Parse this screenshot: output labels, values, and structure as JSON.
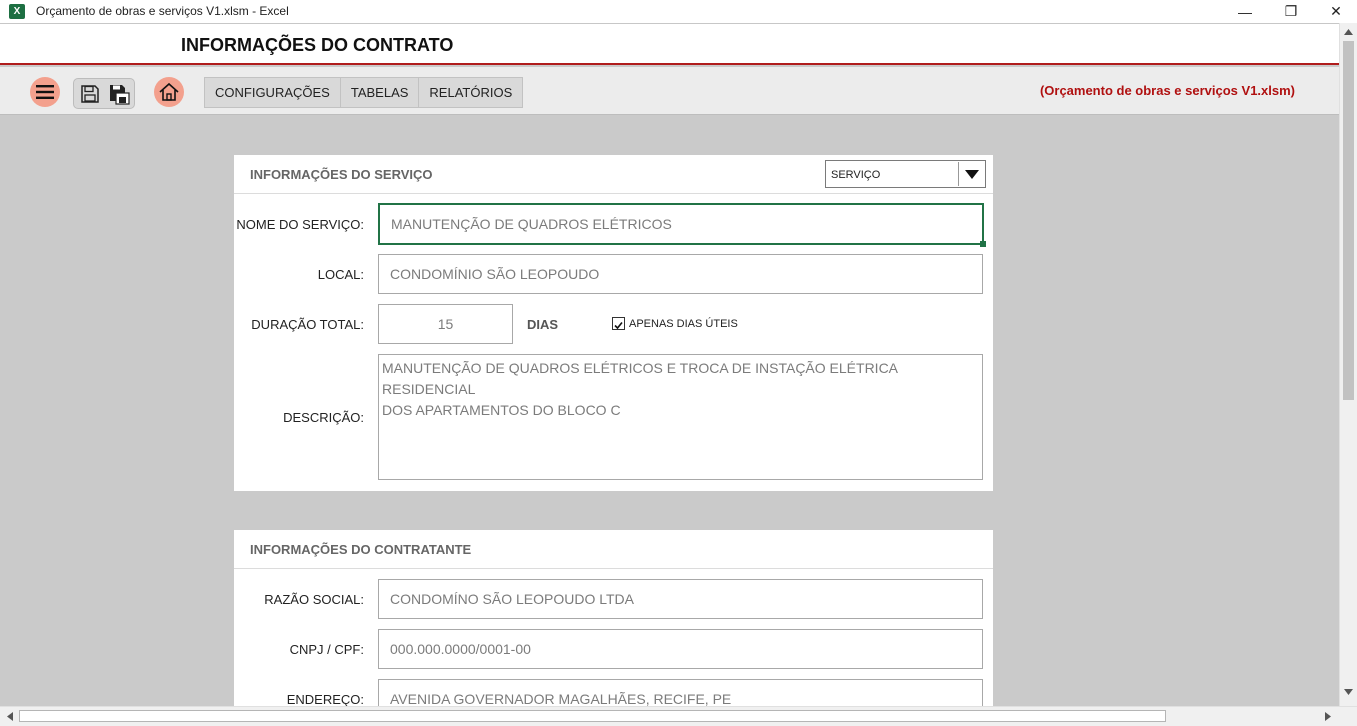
{
  "window": {
    "app_icon": "X",
    "title": "Orçamento de obras e serviços V1.xlsm - Excel",
    "minimize": "—",
    "restore": "❐",
    "close": "✕"
  },
  "header": {
    "title": "INFORMAÇÕES DO CONTRATO"
  },
  "toolbar": {
    "tabs": [
      "CONFIGURAÇÕES",
      "TABELAS",
      "RELATÓRIOS"
    ],
    "file_label": "(Orçamento de obras e serviços V1.xlsm)",
    "accent": "#f3a08d",
    "brand_red": "#b01010"
  },
  "service": {
    "title": "INFORMAÇÕES DO SERVIÇO",
    "dropdown": "SERVIÇO",
    "name_label": "NOME DO SERVIÇO:",
    "name_value": "MANUTENÇÃO DE QUADROS ELÉTRICOS",
    "local_label": "LOCAL:",
    "local_value": "CONDOMÍNIO SÃO LEOPOUDO",
    "duration_label": "DURAÇÃO TOTAL:",
    "duration_value": "15",
    "days_unit": "DIAS",
    "workdays_label": "APENAS DIAS ÚTEIS",
    "workdays_checked": true,
    "description_label": "DESCRIÇÃO:",
    "description_line1": "MANUTENÇÃO DE QUADROS ELÉTRICOS E TROCA DE INSTAÇÃO ELÉTRICA RESIDENCIAL",
    "description_line2": "DOS APARTAMENTOS DO BLOCO C"
  },
  "contractor": {
    "title": "INFORMAÇÕES DO CONTRATANTE",
    "company_label": "RAZÃO SOCIAL:",
    "company_value": "CONDOMÍNO SÃO LEOPOUDO LTDA",
    "cnpj_label": "CNPJ / CPF:",
    "cnpj_value": "000.000.0000/0001-00",
    "address_label": "ENDEREÇO:",
    "address_value": "AVENIDA GOVERNADOR MAGALHÃES, RECIFE, PE"
  }
}
